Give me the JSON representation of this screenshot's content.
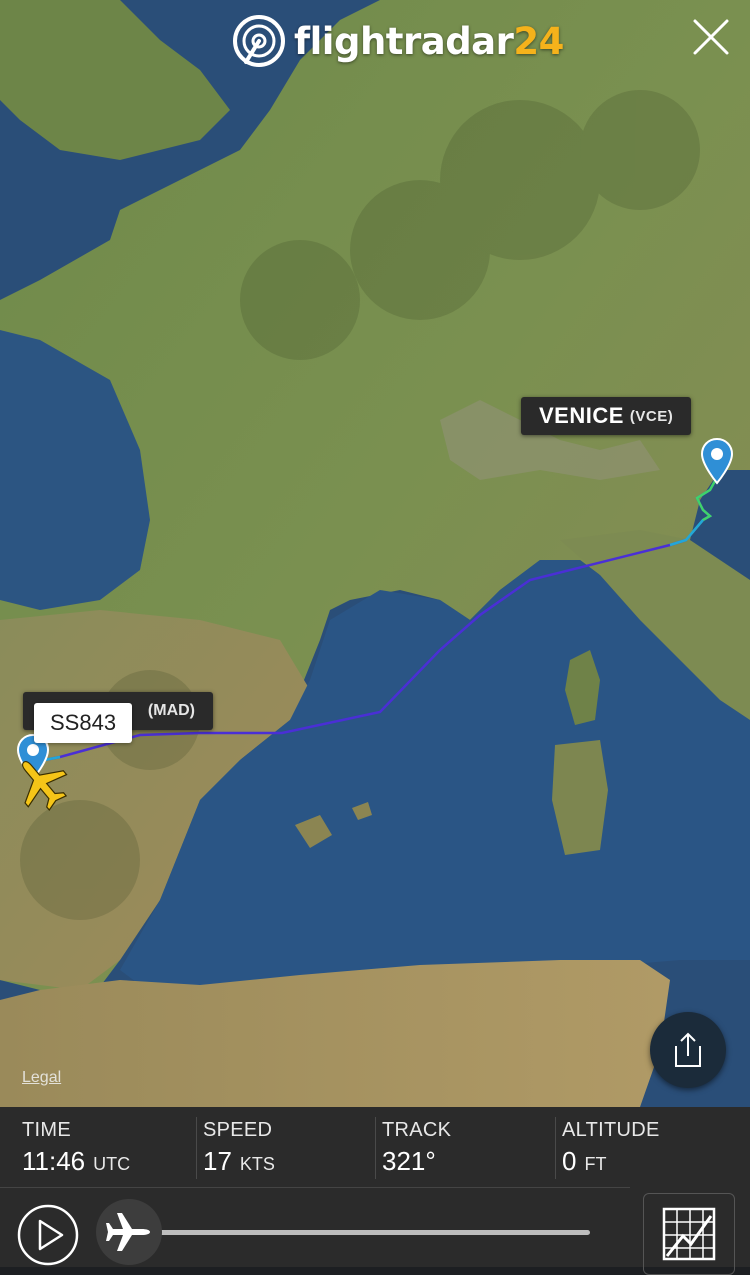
{
  "header": {
    "logo_text": "flightradar",
    "logo_number": "24"
  },
  "map": {
    "destination": {
      "name": "VENICE",
      "code": "(VCE)"
    },
    "origin": {
      "code": "(MAD)"
    },
    "flight": {
      "callsign": "SS843"
    },
    "legal_label": "Legal"
  },
  "stats": {
    "time": {
      "label": "TIME",
      "value": "11:46",
      "unit": "UTC"
    },
    "speed": {
      "label": "SPEED",
      "value": "17",
      "unit": "KTS"
    },
    "track": {
      "label": "TRACK",
      "value": "321°",
      "unit": ""
    },
    "altitude": {
      "label": "ALTITUDE",
      "value": "0",
      "unit": "FT"
    }
  },
  "playback": {
    "progress": 0.0
  },
  "colors": {
    "accent": "#f5b21b",
    "route": "#4a2fd6",
    "route_end": "#22a7d8",
    "marker": "#2f8fd6",
    "panel": "#2b2b2b"
  },
  "icons": [
    "flightradar24-logo",
    "close-icon",
    "location-pin-icon",
    "airplane-icon",
    "share-icon",
    "play-icon",
    "chart-icon"
  ]
}
